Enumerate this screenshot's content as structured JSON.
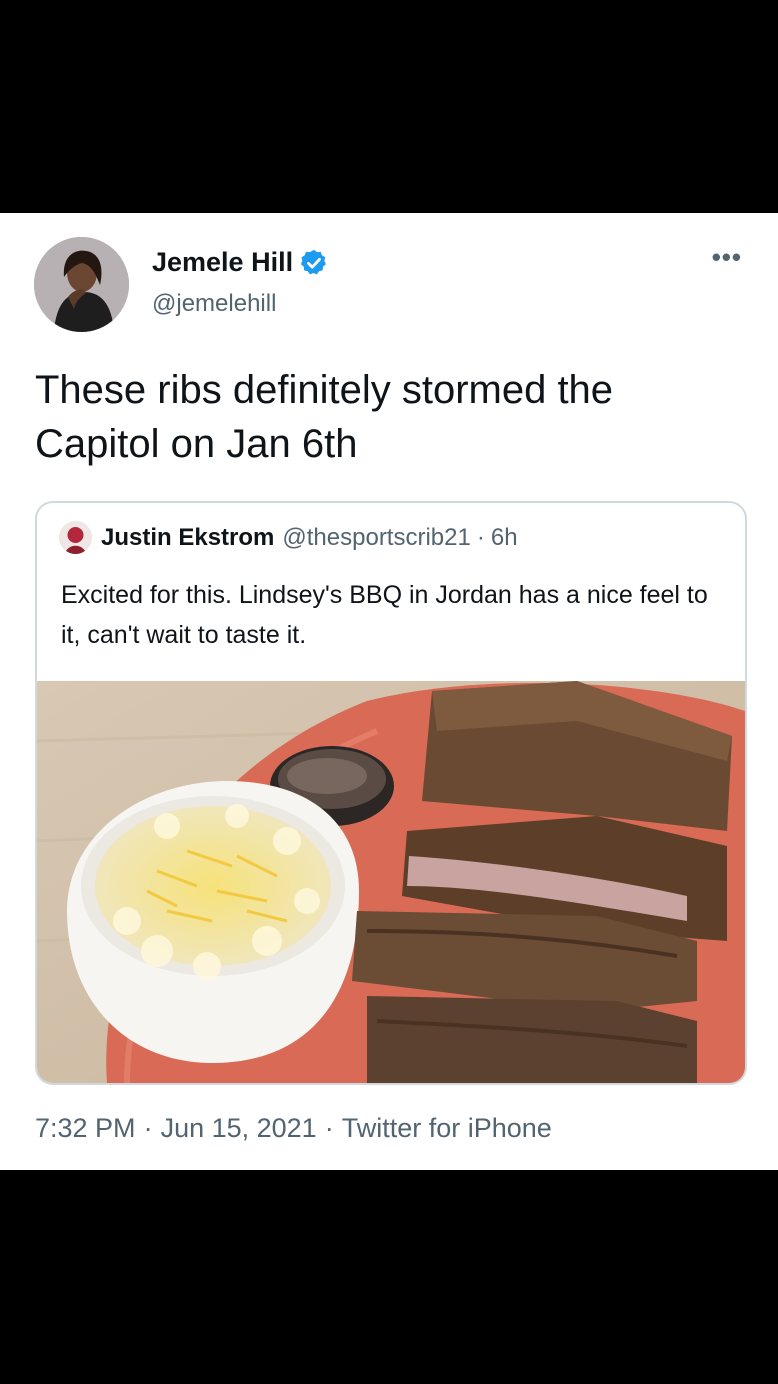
{
  "tweet": {
    "author_name": "Jemele Hill",
    "author_handle": "@jemelehill",
    "verified_icon": "verified-badge-icon",
    "more_icon": "more-options-icon",
    "more_glyph": "•••",
    "text": "These ribs definitely stormed the Capitol on Jan 6th",
    "time": "7:32 PM",
    "separator": "·",
    "date": "Jun 15, 2021",
    "source": "Twitter for iPhone"
  },
  "quoted_tweet": {
    "author_name": "Justin Ekstrom",
    "author_handle": "@thesportscrib21",
    "separator": "·",
    "time_ago": "6h",
    "text": "Excited for this. Lindsey's BBQ in Jordan has a nice feel to it, can't wait to taste it.",
    "photo_icon": "ribs-and-mac-cheese-photo"
  },
  "colors": {
    "text_primary": "#0f1419",
    "text_secondary": "#536471",
    "verified_blue": "#1d9bf0",
    "border": "#cfd9de"
  }
}
